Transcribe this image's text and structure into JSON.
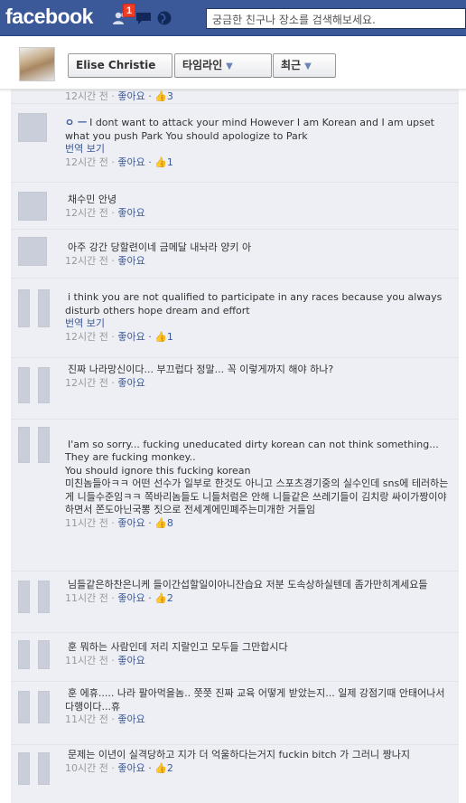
{
  "header": {
    "logo": "facebook",
    "notification_badge": "1",
    "search_placeholder": "궁금한 친구나 장소를 검색해보세요."
  },
  "timeline_header": {
    "name_button": "Elise Christie",
    "timeline_button": "타임라인",
    "recent_button": "최근"
  },
  "comments": [
    {
      "author": "",
      "text": "",
      "time": "12시간 전 · ",
      "like": "좋아요",
      "likes": " · 👍3",
      "translate": ""
    },
    {
      "author": "ㅇ ㅡ",
      "text": "I dont want to attack your mind However I am Korean and I am upset what you push Park You should apologize to Park",
      "translate": "번역 보기",
      "time": "12시간 전 · ",
      "like": "좋아요",
      "likes": " · 👍1"
    },
    {
      "author": "",
      "text": "채수민 안녕",
      "translate": "",
      "time": "12시간 전 · ",
      "like": "좋아요",
      "likes": ""
    },
    {
      "author": "",
      "text": "아주 강간 당할련이네 금메달 내놔라 양키 아",
      "translate": "",
      "time": "12시간 전 · ",
      "like": "좋아요",
      "likes": ""
    },
    {
      "author": "",
      "text": "i think you are not qualified to participate in any races because you always disturb others hope dream and effort",
      "translate": "번역 보기",
      "time": "12시간 전 · ",
      "like": "좋아요",
      "likes": " · 👍1"
    },
    {
      "author": "",
      "text": "진짜 나라망신이다... 부끄럽다 정말... 꼭 이렇게까지 해야 하나?",
      "translate": "",
      "time": "12시간 전 · ",
      "like": "좋아요",
      "likes": ""
    },
    {
      "author": "",
      "text": "I'am so sorry... fucking uneducated dirty korean can not think something...\nThey are fucking monkey..\nYou should ignore this fucking korean\n미친놈들아ㅋㅋ 어떤 선수가 일부로 한것도 아니고 스포츠경기중의 실수인데 sns에 테러하는게 니들수준임ㅋㅋ 쪽바리놈들도 니들처럼은 안해 니들같은 쓰레기들이 김치랑 싸이가짱이야 하면서 쫀도아닌국뽕 짓으로 전세계에민폐주는미개한 거들임",
      "translate": "",
      "time": "11시간 전 · ",
      "like": "좋아요",
      "likes": " · 👍8"
    },
    {
      "author": "",
      "text": "님들같은하찬은니케 들이간섭할일이아니잔습요 저분 도속상하실텐데 좀가만히계세요들",
      "translate": "",
      "time": "11시간 전 · ",
      "like": "좋아요",
      "likes": " · 👍2"
    },
    {
      "author": "",
      "text": "훈 뭐하는 사람인데 저리 지랄인고 모두들 그만합시다",
      "translate": "",
      "time": "11시간 전 · ",
      "like": "좋아요",
      "likes": ""
    },
    {
      "author": "",
      "text": "훈 에휴..... 나라 팔아먹을놈.. 쯧쯧 진짜 교육 어떻게 받았는지... 일제 강점기때 안태어나서 다행이다...휴",
      "translate": "",
      "time": "11시간 전 · ",
      "like": "좋아요",
      "likes": ""
    },
    {
      "author": "",
      "text": "문제는 이년이 실격당하고 지가 더 억울하다는거지 fuckin bitch 가 그러니 짱나지",
      "translate": "",
      "time": "10시간 전 · ",
      "like": "좋아요",
      "likes": " · 👍2"
    }
  ],
  "colors": {
    "brand_blue": "#3b5998",
    "comment_bg": "#edeff4",
    "badge_red": "#f03d25"
  },
  "icons": [
    "friends-icon",
    "messages-icon",
    "globe-icon",
    "caret-down-icon",
    "thumbs-up-icon"
  ]
}
